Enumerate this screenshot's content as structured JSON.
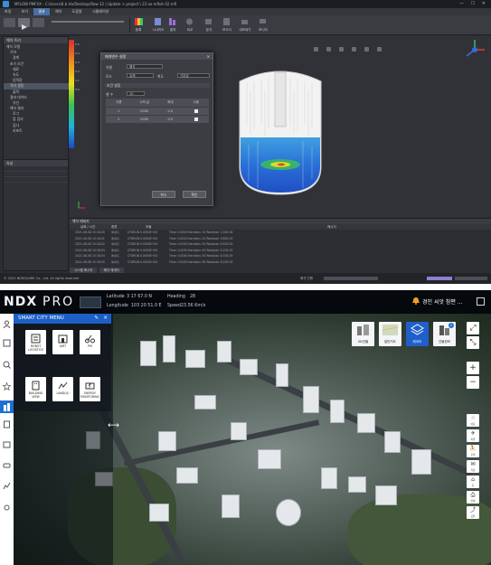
{
  "sim": {
    "title_text": "MFLOW PMFXX - C:\\Users\\K.b.Hn/Desktop\\flow-12 | Update > project \\ 23 ae mfloh 02.mfl",
    "menu": [
      "파일",
      "보기",
      "결과",
      "해석",
      "도움말",
      "시뮬레이션"
    ],
    "menu_active_index": 2,
    "toolbar_labels": [
      "등록",
      "시나리오",
      "결과",
      "비교",
      "분석",
      "보고서",
      "내보내기",
      "모니터"
    ],
    "left_tree": {
      "header": "해석 트리",
      "items": [
        "해석 모델",
        "기하",
        "경계",
        "초기 조건",
        "재료",
        "속도",
        "압력장",
        "격자 설정",
        "출력",
        "결과 데이터",
        "유선",
        "해석 결과",
        "로그",
        "점 검사",
        "검사",
        "리포트"
      ],
      "selected_index": 7
    },
    "colorbar": {
      "ticks": [
        "0.5",
        "0.4",
        "0.3",
        "0.2",
        "0.1",
        "0.0"
      ]
    },
    "props_header": "속성",
    "dialog": {
      "title": "매개변수 설정",
      "labels": {
        "type": "유형",
        "mode": "모드",
        "scale": "척도",
        "section": "설정",
        "rows": "행 수"
      },
      "selects": {
        "type": "해석",
        "mode": "유체",
        "option": "기본값",
        "rows": "10"
      },
      "section_title": "조건 설정",
      "table_headers": [
        "이름",
        "시작 값",
        "최대",
        "사용"
      ],
      "table_rows": [
        {
          "name": "1",
          "start": "0000",
          "max": "0.0"
        },
        {
          "name": "2",
          "start": "0000",
          "max": "0.0"
        }
      ],
      "ok_label": "확인",
      "cancel_label": "취소"
    },
    "log": {
      "header": "해석 메세지",
      "columns": [
        "날짜 / 시간",
        "종류",
        "모듈",
        "메시지"
      ],
      "rows": [
        {
          "time": "2021-06-08 15:18:00",
          "kind": "메세지",
          "module": "CFDRUN 0.0000E+00",
          "msg": "Time: 0.0000 Iteration: 10  Residual: 1.00E-04"
        },
        {
          "time": "2021-06-08 15:18:01",
          "kind": "메세지",
          "module": "CFDRUN 0.0000E+00",
          "msg": "Time: 0.0010 Iteration: 20  Residual: 9.80E-05"
        },
        {
          "time": "2021-06-08 15:18:02",
          "kind": "메세지",
          "module": "CFDRUN 0.0000E+00",
          "msg": "Time: 0.0020 Iteration: 30  Residual: 9.50E-05"
        },
        {
          "time": "2021-06-08 15:18:03",
          "kind": "메세지",
          "module": "CFDRUN 0.0000E+00",
          "msg": "Time: 0.0030 Iteration: 40  Residual: 9.10E-05"
        },
        {
          "time": "2021-06-08 15:18:04",
          "kind": "메세지",
          "module": "CFDRUN 0.0000E+00",
          "msg": "Time: 0.0040 Iteration: 50  Residual: 8.70E-05"
        },
        {
          "time": "2021-06-08 15:18:05",
          "kind": "메세지",
          "module": "CFDRUN 0.0000E+00",
          "msg": "Time: 0.0050 Iteration: 60  Residual: 8.20E-05"
        }
      ],
      "tabs": [
        "시스템 메시지",
        "해석 메세지"
      ]
    },
    "statusbar": {
      "copyright": "© 2021 NDSQUARE Co., Ltd. All rights reserved",
      "progress_label": "해석 진행"
    }
  },
  "ndx": {
    "logo_main": "NDX",
    "logo_sub": "PRO",
    "latitude_label": "Latitude",
    "latitude_value": "3  17  67.0  N",
    "longitude_label": "Longitude",
    "longitude_value": "103  20  51.0  E",
    "heading_label": "Heading",
    "heading_value": "28",
    "speed_label": "Speed",
    "speed_value": "23.56 Km/s",
    "user_text": "경인 씨앗 참편 ...",
    "menu_title": "SMART CITY MENU",
    "menu_items": [
      "ROBOT LOGISTICS",
      "AIRT",
      "PM",
      "BUILDING VIEW",
      "LAND(LI)",
      "ENERGY MONITORING"
    ],
    "layers": [
      {
        "label": "3D건물",
        "active": false
      },
      {
        "label": "일반지도",
        "active": false
      },
      {
        "label": "레이어",
        "active": true
      },
      {
        "label": "건물정보",
        "active": false,
        "badge": "2"
      }
    ],
    "right_tools": [
      {
        "glyph": "⤢",
        "label": ""
      },
      {
        "glyph": "⤡",
        "label": ""
      },
      {
        "glyph": "+",
        "label": ""
      },
      {
        "glyph": "−",
        "label": ""
      },
      {
        "glyph": "☝",
        "label": "이동"
      },
      {
        "glyph": "✈",
        "label": "비행"
      },
      {
        "glyph": "⛹",
        "label": "보행"
      },
      {
        "glyph": "✉",
        "label": "측정"
      },
      {
        "glyph": "⌂",
        "label": "홈"
      },
      {
        "glyph": "⎙",
        "label": "인쇄"
      },
      {
        "glyph": "⤴",
        "label": "공유"
      }
    ],
    "colors": {
      "accent": "#1f6ed4",
      "menu_header": "#1c5fc7",
      "header_bg": "#05080c"
    }
  }
}
